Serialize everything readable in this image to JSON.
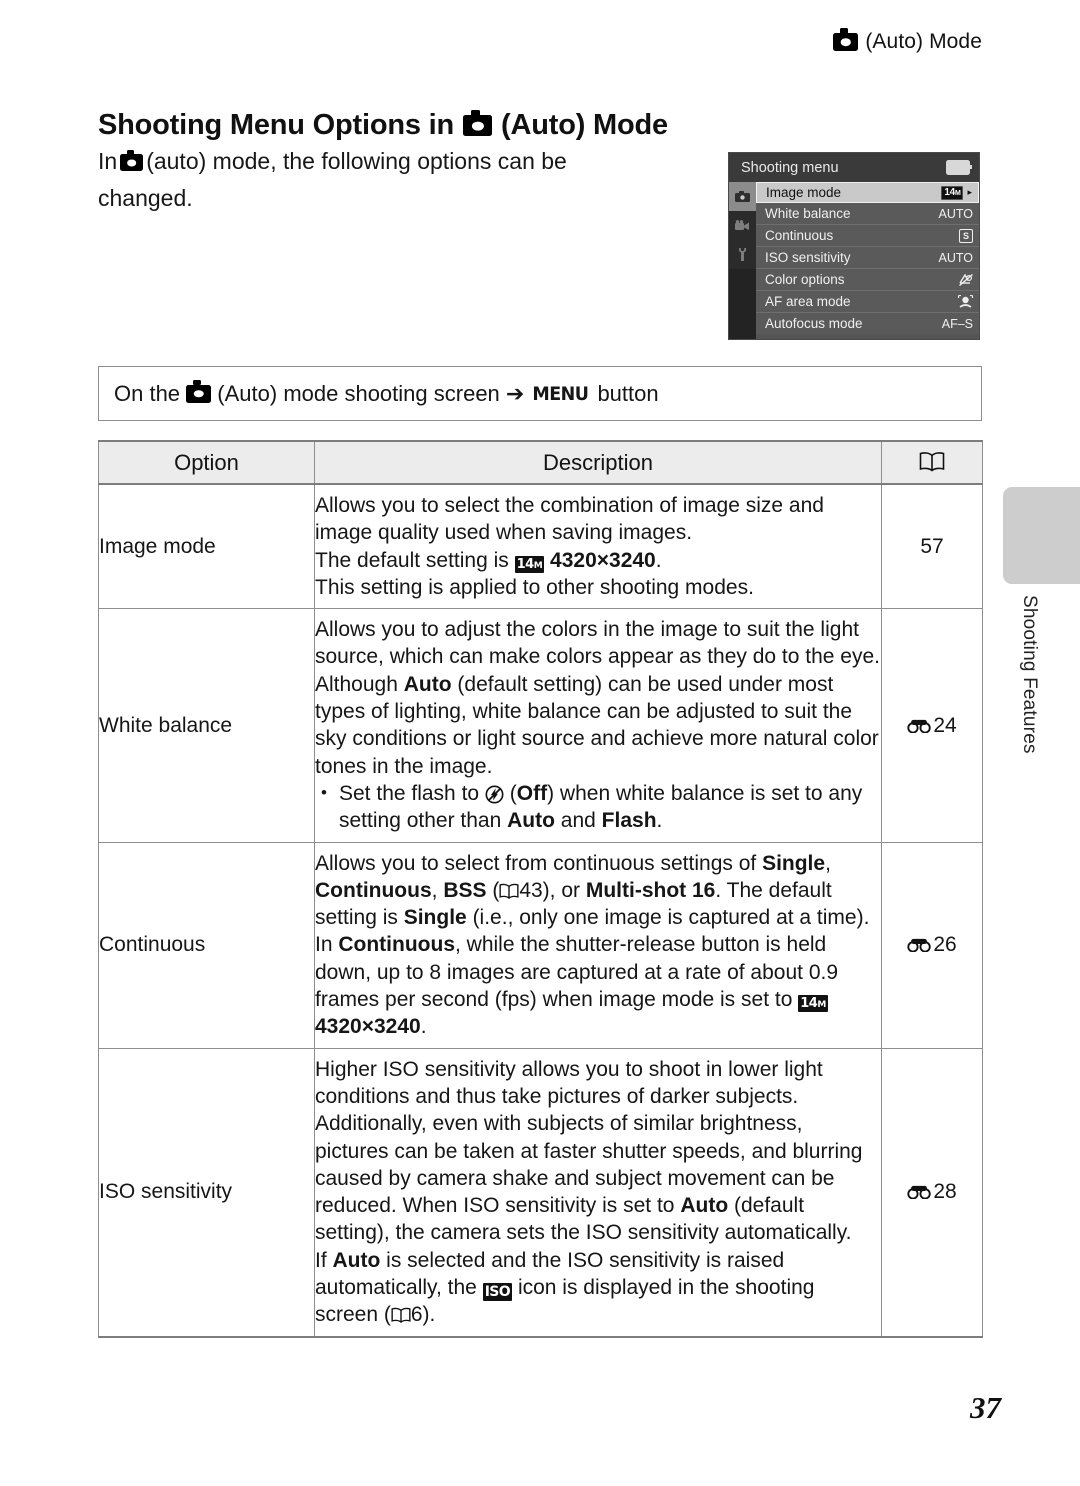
{
  "running_head": {
    "text": "(Auto) Mode",
    "icon": "camera-icon"
  },
  "title": {
    "prefix": "Shooting Menu Options in",
    "suffix": "(Auto) Mode",
    "icon": "camera-icon"
  },
  "intro": {
    "before": "In",
    "after": "(auto) mode, the following options can be changed."
  },
  "camera_menu": {
    "title": "Shooting menu",
    "battery_icon": "battery-icon",
    "tabs": [
      {
        "name": "shooting-tab",
        "icon": "camera-icon",
        "active": true
      },
      {
        "name": "movie-tab",
        "icon": "movie-camera-icon",
        "active": false
      },
      {
        "name": "setup-tab",
        "icon": "wrench-icon",
        "active": false
      }
    ],
    "rows": [
      {
        "label": "Image mode",
        "value": "14M",
        "value_type": "badge",
        "selected": true,
        "arrow": "▸"
      },
      {
        "label": "White balance",
        "value": "AUTO",
        "value_type": "text",
        "selected": false
      },
      {
        "label": "Continuous",
        "value": "S",
        "value_type": "boxed",
        "selected": false
      },
      {
        "label": "ISO sensitivity",
        "value": "AUTO",
        "value_type": "text",
        "selected": false
      },
      {
        "label": "Color options",
        "value": "colour-off-icon",
        "value_type": "icon",
        "selected": false
      },
      {
        "label": "AF area mode",
        "value": "face-priority-icon",
        "value_type": "icon",
        "selected": false
      },
      {
        "label": "Autofocus mode",
        "value": "AF–S",
        "value_type": "text",
        "selected": false
      }
    ]
  },
  "menu_path": {
    "before": "On the",
    "middle": "(Auto) mode shooting screen",
    "arrow": "➔",
    "button": "MENU",
    "after": "button"
  },
  "table": {
    "headers": {
      "option": "Option",
      "description": "Description",
      "reference": "book-icon"
    },
    "rows": [
      {
        "option": "Image mode",
        "reference": "57",
        "reference_icon": "none",
        "lines": [
          "Allows you to select the combination of image size and image quality used when saving images.",
          "The default setting is  4320×3240.",
          "This setting is applied to other shooting modes."
        ]
      },
      {
        "option": "White balance",
        "reference": "24",
        "reference_icon": "E-symbol",
        "lines": [
          "Allows you to adjust the colors in the image to suit the light source, which can make colors appear as they do to the eye. Although Auto (default setting) can be used under most types of lighting, white balance can be adjusted to suit the sky conditions or light source and achieve more natural color tones in the image.",
          "Set the flash to  (Off) when white balance is set to any setting other than Auto and Flash."
        ]
      },
      {
        "option": "Continuous",
        "reference": "26",
        "reference_icon": "E-symbol",
        "lines": [
          "Allows you to select from continuous settings of Single, Continuous, BSS (43), or Multi-shot 16. The default setting is Single (i.e., only one image is captured at a time).",
          "In Continuous, while the shutter-release button is held down, up to 8 images are captured at a rate of about 0.9 frames per second (fps) when image mode is set to  4320×3240."
        ]
      },
      {
        "option": "ISO sensitivity",
        "reference": "28",
        "reference_icon": "E-symbol",
        "lines": [
          "Higher ISO sensitivity allows you to shoot in lower light conditions and thus take pictures of darker subjects. Additionally, even with subjects of similar brightness, pictures can be taken at faster shutter speeds, and blurring caused by camera shake and subject movement can be reduced. When ISO sensitivity is set to Auto (default setting), the camera sets the ISO sensitivity automatically.",
          "If Auto is selected and the ISO sensitivity is raised automatically, the ISO icon is displayed in the shooting screen (6)."
        ]
      }
    ]
  },
  "side_tab": {
    "label": "Shooting Features",
    "color": "#cdcdcd"
  },
  "page_number": "37",
  "colors": {
    "header_bg": "#ececec",
    "rule": "#7d7d7d",
    "border": "#8e8e8e",
    "menu_bg": "#555555"
  }
}
